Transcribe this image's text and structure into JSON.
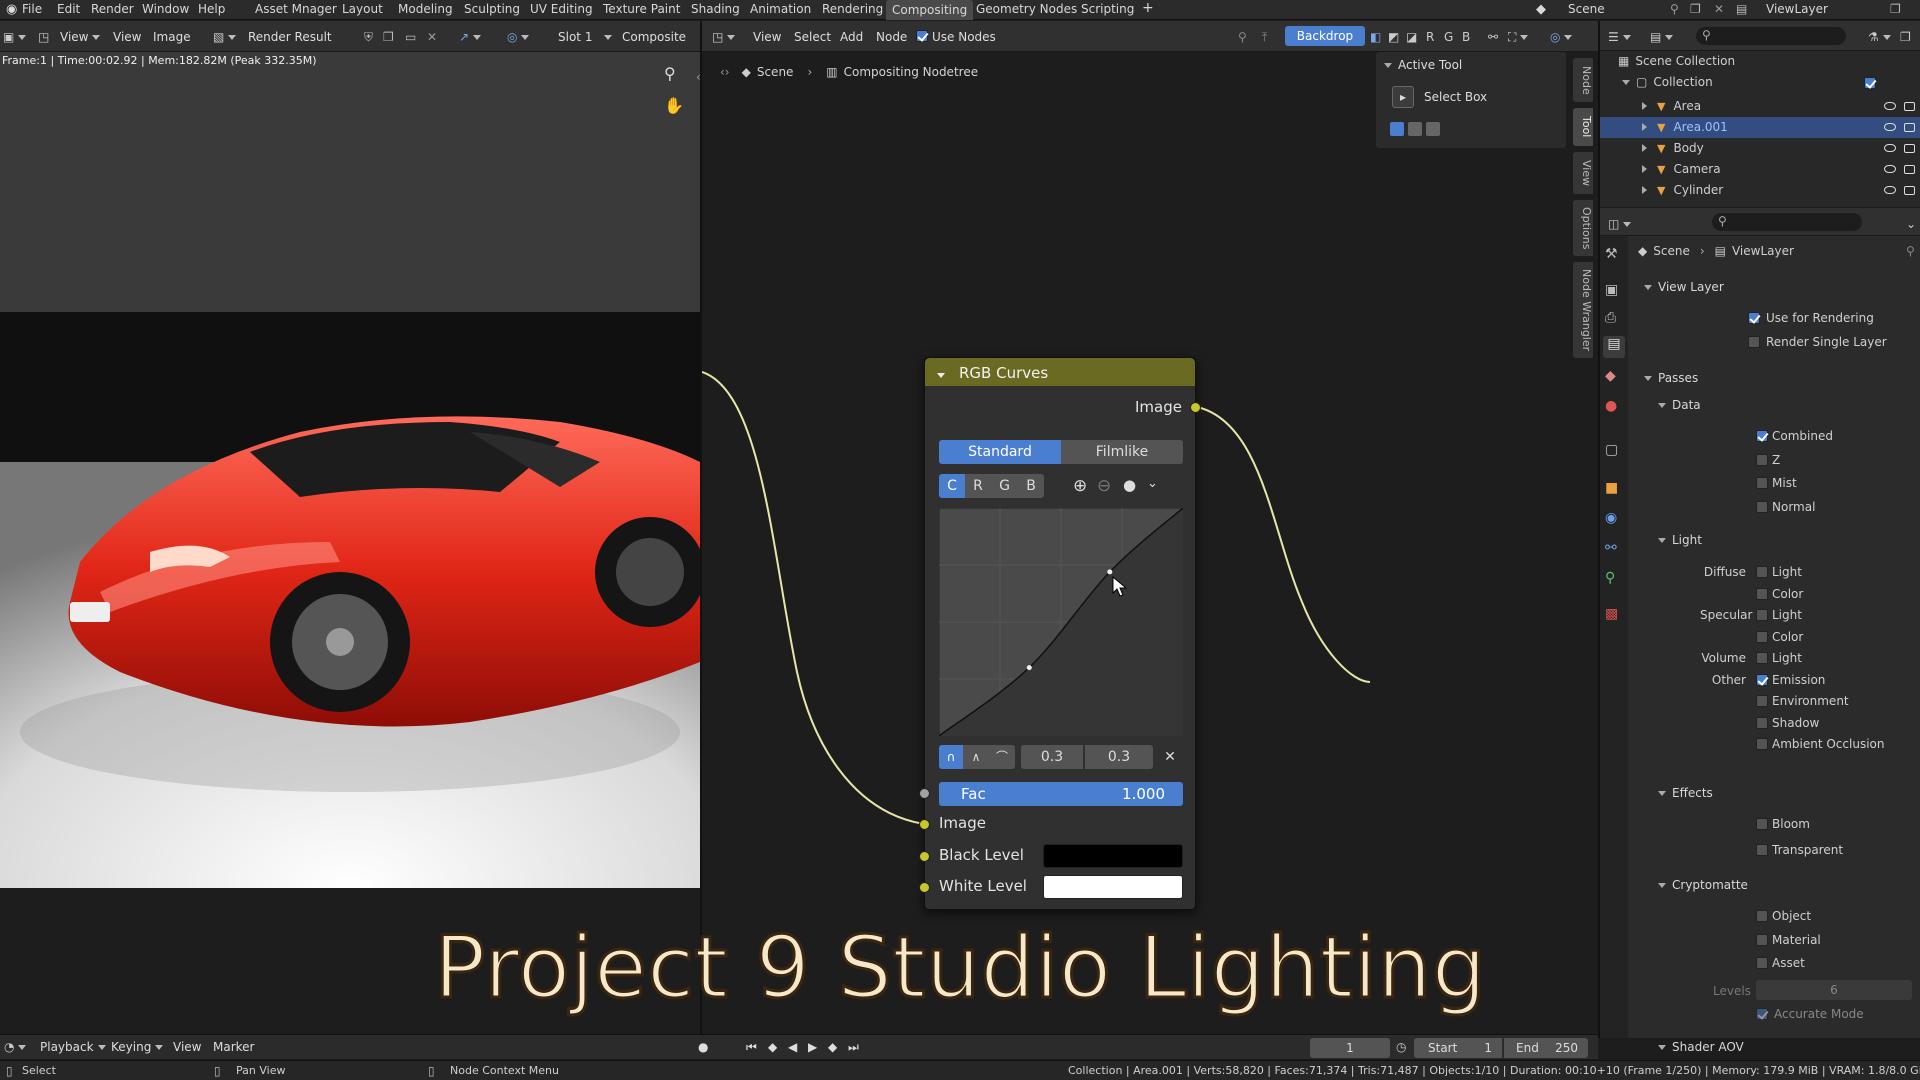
{
  "top_menu": [
    "File",
    "Edit",
    "Render",
    "Window",
    "Help"
  ],
  "workspaces": [
    "Asset Mnager",
    "Layout",
    "Modeling",
    "Sculpting",
    "UV Editing",
    "Texture Paint",
    "Shading",
    "Animation",
    "Rendering",
    "Compositing",
    "Geometry Nodes",
    "Scripting",
    "+"
  ],
  "active_workspace": "Compositing",
  "scene_name": "Scene",
  "view_layer_name": "ViewLayer",
  "image_editor": {
    "menus": [
      "View",
      "View",
      "Image"
    ],
    "image_name": "Render Result",
    "slot": "Slot 1",
    "layer": "Composite",
    "info_text": "Frame:1 | Time:00:02.92 | Mem:182.82M (Peak 332.35M)"
  },
  "node_editor": {
    "menus": [
      "View",
      "Select",
      "Add",
      "Node"
    ],
    "use_nodes_label": "Use Nodes",
    "use_nodes_checked": true,
    "backdrop_label": "Backdrop",
    "channels": [
      "R",
      "G",
      "B"
    ],
    "breadcrumb": [
      "Scene",
      "Compositing Nodetree"
    ],
    "active_tool_title": "Active Tool",
    "active_tool_name": "Select Box",
    "side_tabs": [
      "Node",
      "Tool",
      "View",
      "Options",
      "Node Wrangler"
    ]
  },
  "rgb_node": {
    "title": "RGB Curves",
    "output_label": "Image",
    "mode_standard": "Standard",
    "mode_filmlike": "Filmlike",
    "channels": [
      "C",
      "R",
      "G",
      "B"
    ],
    "point_x": "0.3",
    "point_y": "0.3",
    "fac_label": "Fac",
    "fac_value": "1.000",
    "input_image": "Image",
    "black_level": "Black Level",
    "white_level": "White Level",
    "curve_points": [
      [
        0,
        0
      ],
      [
        0.37,
        0.3
      ],
      [
        0.7,
        0.72
      ],
      [
        1,
        1
      ]
    ]
  },
  "outliner": {
    "root": "Scene Collection",
    "collection": "Collection",
    "items": [
      {
        "name": "Area",
        "selected": false,
        "color": "#e8a040"
      },
      {
        "name": "Area.001",
        "selected": true,
        "color": "#e8a040"
      },
      {
        "name": "Body",
        "selected": false,
        "color": "#e8a040"
      },
      {
        "name": "Camera",
        "selected": false,
        "color": "#e8a040"
      },
      {
        "name": "Cylinder",
        "selected": false,
        "color": "#e8a040"
      }
    ]
  },
  "properties": {
    "breadcrumb": [
      "Scene",
      "ViewLayer"
    ],
    "view_layer_section": "View Layer",
    "use_for_rendering": "Use for Rendering",
    "render_single_layer": "Render Single Layer",
    "passes": "Passes",
    "data": "Data",
    "data_items": [
      {
        "label": "Combined",
        "checked": true
      },
      {
        "label": "Z",
        "checked": false
      },
      {
        "label": "Mist",
        "checked": false
      },
      {
        "label": "Normal",
        "checked": false
      }
    ],
    "light": "Light",
    "light_rows": [
      {
        "group": "Diffuse",
        "label": "Light",
        "checked": false
      },
      {
        "group": "",
        "label": "Color",
        "checked": false
      },
      {
        "group": "Specular",
        "label": "Light",
        "checked": false
      },
      {
        "group": "",
        "label": "Color",
        "checked": false
      },
      {
        "group": "Volume",
        "label": "Light",
        "checked": false
      },
      {
        "group": "Other",
        "label": "Emission",
        "checked": true
      },
      {
        "group": "",
        "label": "Environment",
        "checked": false
      },
      {
        "group": "",
        "label": "Shadow",
        "checked": false
      },
      {
        "group": "",
        "label": "Ambient Occlusion",
        "checked": false
      }
    ],
    "effects": "Effects",
    "effects_items": [
      {
        "label": "Bloom",
        "checked": false
      },
      {
        "label": "Transparent",
        "checked": false
      }
    ],
    "cryptomatte": "Cryptomatte",
    "crypto_items": [
      {
        "label": "Object",
        "checked": false
      },
      {
        "label": "Material",
        "checked": false
      },
      {
        "label": "Asset",
        "checked": false
      }
    ],
    "levels_label": "Levels",
    "levels_value": "6",
    "accurate_mode": "Accurate Mode",
    "shader_aov": "Shader AOV"
  },
  "timeline": {
    "menus": [
      "Playback",
      "Keying",
      "View",
      "Marker"
    ],
    "current_frame": "1",
    "start_label": "Start",
    "start_value": "1",
    "end_label": "End",
    "end_value": "250"
  },
  "statusbar": {
    "select": "Select",
    "pan_view": "Pan View",
    "node_context": "Node Context Menu",
    "stats": "Collection | Area.001 | Verts:58,820 | Faces:71,374 | Tris:71,487 | Objects:1/10 | Duration: 00:10+10 (Frame 1/250) | Memory: 179.9 MiB | VRAM: 1.8/8.0 GiB | 3.6"
  },
  "overlay_title": "Project 9 Studio Lighting"
}
